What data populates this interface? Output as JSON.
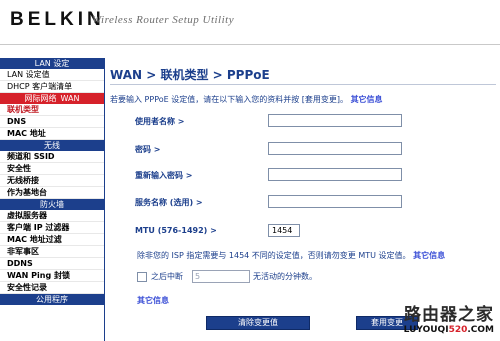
{
  "header": {
    "logo": "BELKIN",
    "tagline": "Wireless Router Setup Utility"
  },
  "sidebar": {
    "sections": [
      {
        "title": "LAN 设定",
        "items": [
          "LAN 设定值",
          "DHCP 客户端清单"
        ]
      },
      {
        "title": "网际网络",
        "title_suffix": "WAN",
        "active": true,
        "items": [
          "联机类型",
          "DNS",
          "MAC 地址"
        ]
      },
      {
        "title": "无线",
        "items": [
          "频道和 SSID",
          "安全性",
          "无线桥接",
          "作为基地台"
        ]
      },
      {
        "title": "防火墙",
        "items": [
          "虚拟服务器",
          "客户端 IP 过滤器",
          "MAC 地址过滤",
          "非军事区",
          "DDNS",
          "WAN Ping 封锁",
          "安全性记录"
        ]
      },
      {
        "title": "公用程序",
        "items": []
      }
    ]
  },
  "main": {
    "title": "WAN > 联机类型 > PPPoE",
    "intro": "若要输入 PPPoE 设定值，请在以下输入您的资料并按 [套用变更]。",
    "more_info": "其它信息",
    "fields": {
      "username_label": "使用者名称 >",
      "username_value": "",
      "password_label": "密码 >",
      "password_value": "",
      "retype_label": "重新输入密码 >",
      "retype_value": "",
      "service_label": "服务名称 (选用) >",
      "service_value": "",
      "mtu_label": "MTU (576-1492) >",
      "mtu_value": "1454"
    },
    "mtu_note": "除非您的 ISP 指定需要与 1454 不同的设定值，否则请勿变更 MTU 设定值。",
    "idle": {
      "checked": false,
      "prefix": "之后中断",
      "value": "5",
      "suffix": "无活动的分钟数。"
    },
    "buttons": {
      "clear": "清除变更值",
      "apply": "套用变更"
    }
  },
  "watermark": {
    "top": "路由器之家",
    "bottom_pre": "LUYOUQI",
    "bottom_accent": "520",
    "bottom_post": ".COM"
  }
}
